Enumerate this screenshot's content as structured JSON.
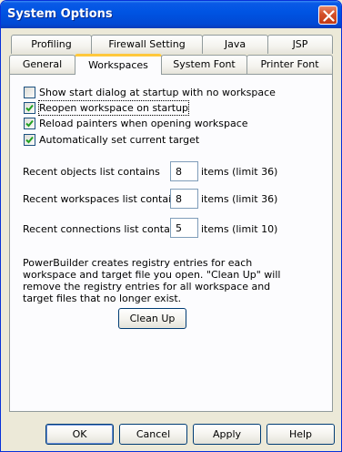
{
  "window": {
    "title": "System Options"
  },
  "tabs_row1": [
    "Profiling",
    "Firewall Setting",
    "Java",
    "JSP"
  ],
  "tabs_row2": [
    "General",
    "Workspaces",
    "System Font",
    "Printer Font"
  ],
  "active_tab": "Workspaces",
  "checkboxes": [
    {
      "label": "Show start dialog at startup with no workspace",
      "checked": false
    },
    {
      "label": "Reopen workspace on startup",
      "checked": true
    },
    {
      "label": "Reload painters when opening workspace",
      "checked": true
    },
    {
      "label": "Automatically set current target",
      "checked": true
    }
  ],
  "recent_lists": [
    {
      "label": "Recent objects list contains",
      "value": "8",
      "suffix": "items (limit 36)"
    },
    {
      "label": "Recent workspaces list contains",
      "value": "8",
      "suffix": "items (limit 36)"
    },
    {
      "label": "Recent connections list contains",
      "value": "5",
      "suffix": "items (limit 10)"
    }
  ],
  "info_text": "PowerBuilder creates registry entries for each workspace and target file you open. \"Clean Up\" will remove the registry entries for all workspace and target files that no longer exist.",
  "buttons": {
    "cleanup": "Clean Up",
    "ok": "OK",
    "cancel": "Cancel",
    "apply": "Apply",
    "help": "Help"
  },
  "colors": {
    "titlebar": "#0054e3",
    "active_tab_accent": "#ffc83c",
    "dialog_bg": "#ece9d8"
  }
}
